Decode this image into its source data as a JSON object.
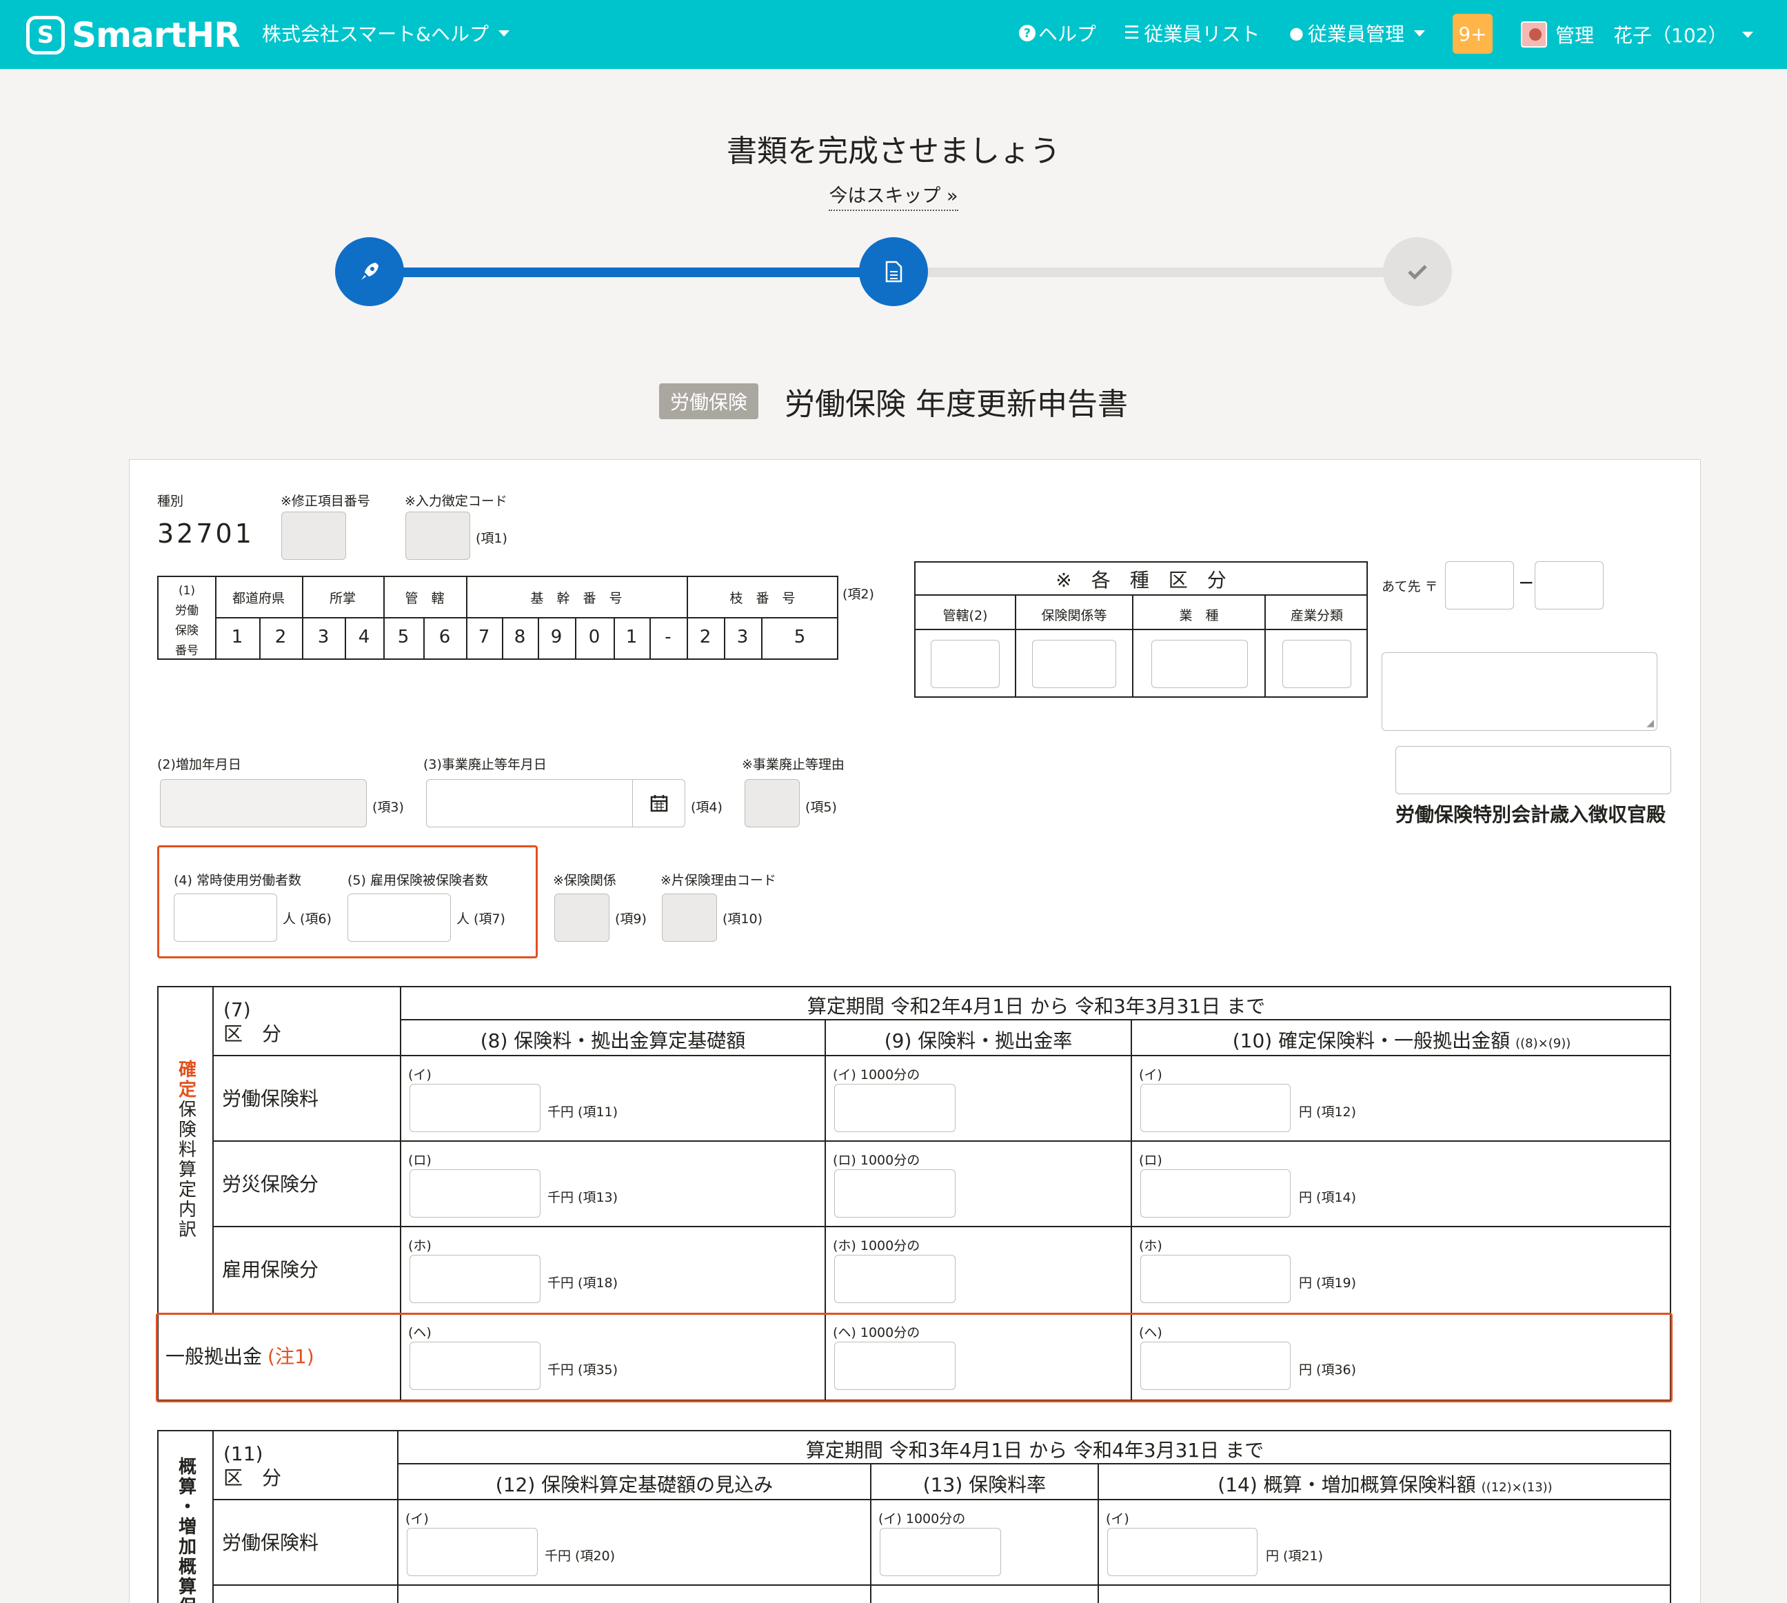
{
  "header": {
    "brand": "SmartHR",
    "company": "株式会社スマート&ヘルプ",
    "help": "ヘルプ",
    "employee_list": "従業員リスト",
    "employee_mgmt": "従業員管理",
    "badge": "9+",
    "user": "管理　花子（102）"
  },
  "page": {
    "title": "書類を完成させましょう",
    "skip": "今はスキップ »",
    "doc_tag": "労働保険",
    "doc_title": "労働保険 年度更新申告書"
  },
  "form": {
    "shubetsu_label": "種別",
    "shubetsu_value": "32701",
    "shusei_label": "※修正項目番号",
    "nyuryoku_label": "※入力徴定コード",
    "ko1": "(項1)",
    "ko2": "(項2)",
    "bango_head": [
      "(1)",
      "労働",
      "保険",
      "番号"
    ],
    "bango_cols": [
      "都道府県",
      "所掌",
      "管　轄",
      "基　幹　番　号",
      "枝　番　号"
    ],
    "bango_digits": [
      "1",
      "2",
      "3",
      "4",
      "5",
      "6",
      "7",
      "8",
      "9",
      "0",
      "1",
      "-",
      "2",
      "3",
      "5"
    ],
    "kakushu_title": "※　各　種　区　分",
    "kakushu_cols": [
      "管轄(2)",
      "保険関係等",
      "業　種",
      "産業分類"
    ],
    "atesaki": "あて先 〒",
    "dash": "−",
    "kanshu": "労働保険特別会計歳入徴収官殿",
    "zouka_label": "(2)増加年月日",
    "ko3": "(項3)",
    "haishi_label": "(3)事業廃止等年月日",
    "ko4": "(項4)",
    "haishi_riyu_label": "※事業廃止等理由",
    "ko5": "(項5)",
    "joji_label": "(4) 常時使用労働者数",
    "hihoken_label": "(5) 雇用保険被保険者数",
    "ko6": "人 (項6)",
    "ko7": "人 (項7)",
    "hoken_kankei_label": "※保険関係",
    "ko9": "(項9)",
    "kata_label": "※片保険理由コード",
    "ko10": "(項10)",
    "t1": {
      "side": [
        "確",
        "定",
        "保",
        "険",
        "料",
        "算",
        "定",
        "内",
        "訳"
      ],
      "kubun_no": "(7)",
      "kubun": "区　分",
      "period": "算定期間 令和2年4月1日 から 令和3年3月31日 まで",
      "c8": "(8) 保険料・拠出金算定基礎額",
      "c9": "(9) 保険料・拠出金率",
      "c10": "(10) 確定保険料・一般拠出金額",
      "c10_sub": "((8)×(9))",
      "rows": [
        {
          "name": "労働保険料",
          "k": "(イ)",
          "rate": "(イ) 1000分の",
          "u1": "千円 (項11)",
          "u3": "円 (項12)"
        },
        {
          "name": "労災保険分",
          "k": "(ロ)",
          "rate": "(ロ) 1000分の",
          "u1": "千円 (項13)",
          "u3": "円 (項14)"
        },
        {
          "name": "雇用保険分",
          "k": "(ホ)",
          "rate": "(ホ) 1000分の",
          "u1": "千円 (項18)",
          "u3": "円 (項19)"
        },
        {
          "name": "一般拠出金",
          "note": "(注1)",
          "k": "(ヘ)",
          "rate": "(ヘ) 1000分の",
          "u1": "千円 (項35)",
          "u3": "円 (項36)"
        }
      ]
    },
    "t2": {
      "side": [
        "概",
        "算",
        "・",
        "増",
        "加",
        "概",
        "算",
        "保"
      ],
      "kubun_no": "(11)",
      "kubun": "区　分",
      "period": "算定期間 令和3年4月1日 から 令和4年3月31日 まで",
      "c12": "(12) 保険料算定基礎額の見込み",
      "c13": "(13) 保険料率",
      "c14": "(14) 概算・増加概算保険料額",
      "c14_sub": "((12)×(13))",
      "rows": [
        {
          "name": "労働保険料",
          "k": "(イ)",
          "rate": "(イ) 1000分の",
          "u1": "千円 (項20)",
          "u3": "円 (項21)"
        }
      ]
    }
  },
  "colors": {
    "header": "#00c4cc",
    "accent": "#0f6fc6",
    "highlight": "#e2511c",
    "badge": "#ffb547"
  }
}
